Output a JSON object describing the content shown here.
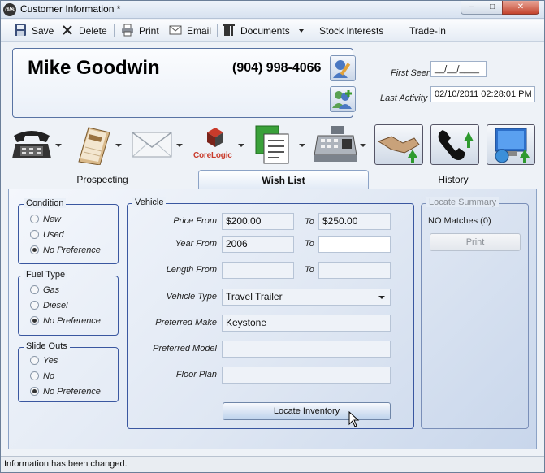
{
  "window": {
    "title": "Customer Information *",
    "controls": {
      "minimize": "–",
      "maximize": "□",
      "close": "✕"
    }
  },
  "toolbar": {
    "save_label": "Save",
    "delete_label": "Delete",
    "print_label": "Print",
    "email_label": "Email",
    "documents_label": "Documents",
    "stock_interests_label": "Stock Interests",
    "trade_in_label": "Trade-In"
  },
  "customer": {
    "name": "Mike Goodwin",
    "phone": "(904) 998-4066",
    "first_seen_label": "First Seen",
    "first_seen_value": "__/__/____",
    "last_activity_label": "Last Activity",
    "last_activity_value": "02/10/2011 02:28:01 PM"
  },
  "actions": {
    "corelogic_label": "CoreLogic"
  },
  "tabs": [
    {
      "label": "Prospecting",
      "active": false
    },
    {
      "label": "Wish List",
      "active": true
    },
    {
      "label": "History",
      "active": false
    }
  ],
  "condition": {
    "title": "Condition",
    "options": [
      {
        "label": "New",
        "checked": false
      },
      {
        "label": "Used",
        "checked": false
      },
      {
        "label": "No Preference",
        "checked": true
      }
    ]
  },
  "fuel_type": {
    "title": "Fuel Type",
    "options": [
      {
        "label": "Gas",
        "checked": false
      },
      {
        "label": "Diesel",
        "checked": false
      },
      {
        "label": "No Preference",
        "checked": true
      }
    ]
  },
  "slide_outs": {
    "title": "Slide Outs",
    "options": [
      {
        "label": "Yes",
        "checked": false
      },
      {
        "label": "No",
        "checked": false
      },
      {
        "label": "No Preference",
        "checked": true
      }
    ]
  },
  "vehicle": {
    "title": "Vehicle",
    "to_label": "To",
    "price_from_label": "Price From",
    "price_from_value": "$200.00",
    "price_to_value": "$250.00",
    "year_from_label": "Year From",
    "year_from_value": "2006",
    "year_to_value": "",
    "length_from_label": "Length From",
    "length_from_value": "",
    "length_to_value": "",
    "vehicle_type_label": "Vehicle Type",
    "vehicle_type_value": "Travel Trailer",
    "preferred_make_label": "Preferred Make",
    "preferred_make_value": "Keystone",
    "preferred_model_label": "Preferred Model",
    "preferred_model_value": "",
    "floor_plan_label": "Floor Plan",
    "floor_plan_value": "",
    "locate_button_label": "Locate Inventory"
  },
  "locate_summary": {
    "title": "Locate Summary",
    "matches_text": "NO Matches (0)",
    "print_label": "Print"
  },
  "status": {
    "message": "Information has been changed."
  }
}
